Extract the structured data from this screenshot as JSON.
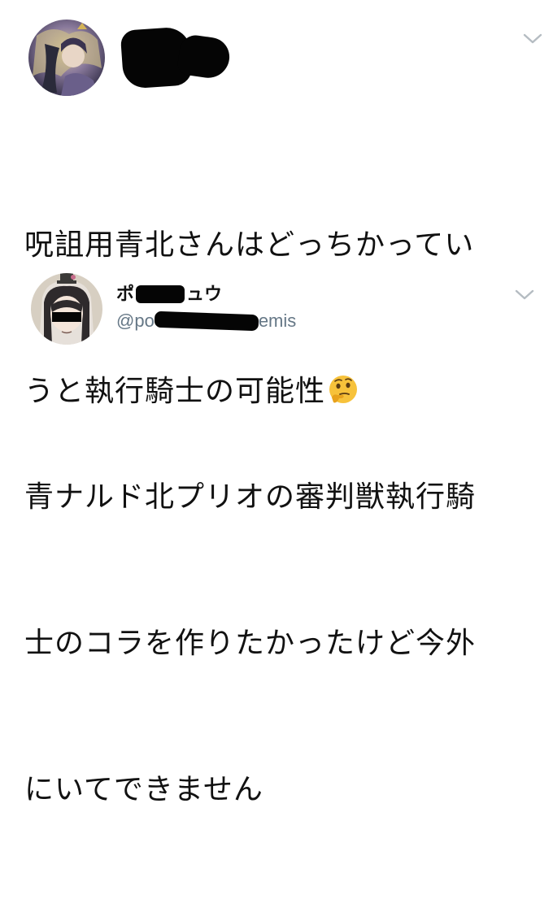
{
  "tweets": [
    {
      "text_line1": "呪詛用青北さんはどっちかってい",
      "text_line2": "うと執行騎士の可能性",
      "emoji": "thinking-face-emoji"
    },
    {
      "display_name_visible_start": "ポ",
      "display_name_visible_end": "ュウ",
      "handle_visible_start": "@po",
      "handle_visible_end": "emis",
      "text_line1": "青ナルド北プリオの審判獣執行騎",
      "text_line2": "士のコラを作りたかったけど今外",
      "text_line3": "にいてできません"
    }
  ],
  "colors": {
    "text": "#111111",
    "handle": "#657786",
    "chevron": "#b5bcc2",
    "redaction": "#050505"
  }
}
